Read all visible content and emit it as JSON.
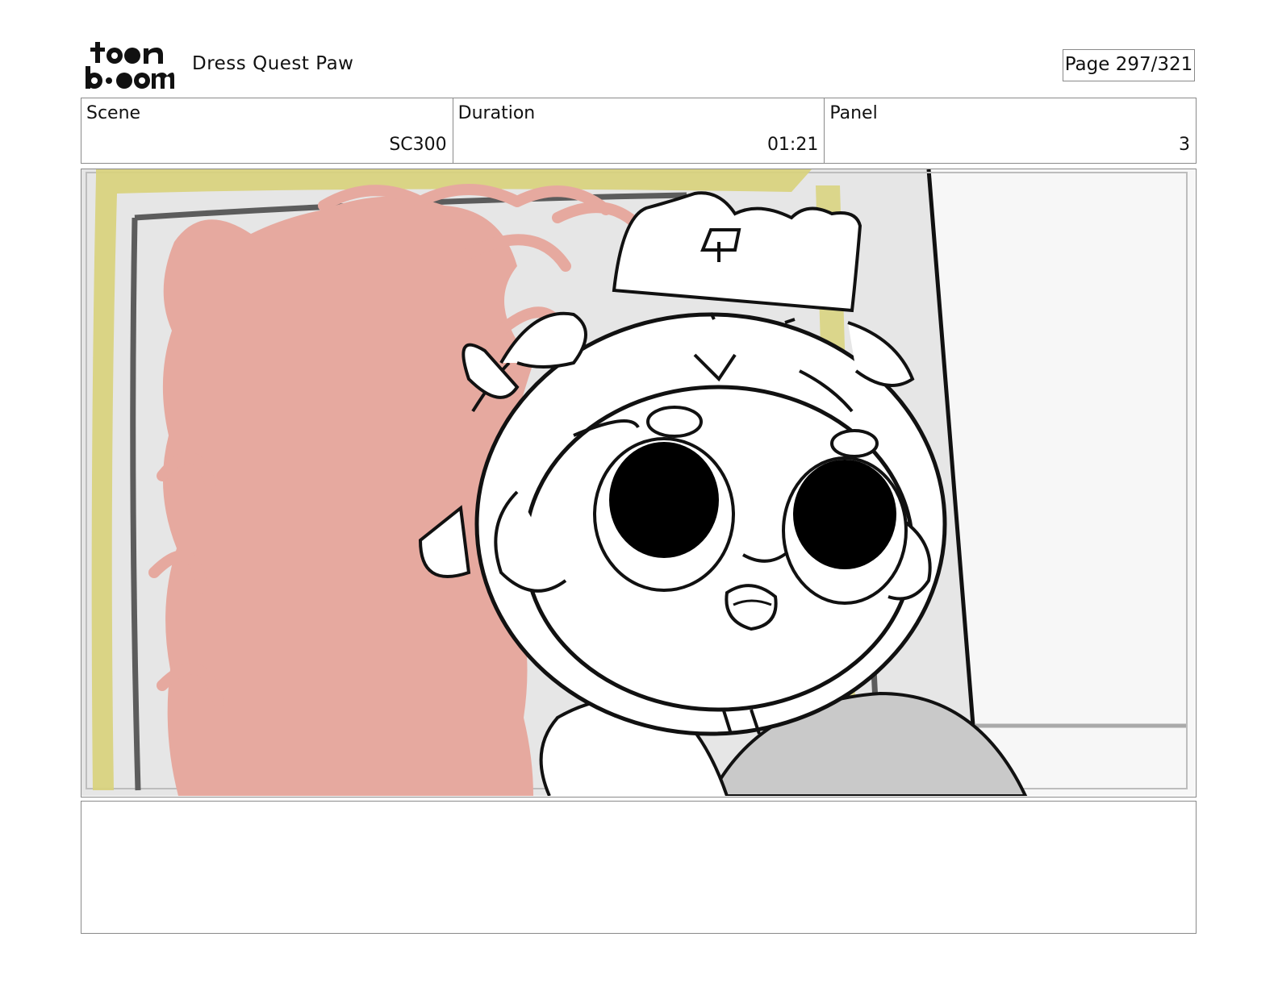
{
  "header": {
    "logo_text": "toonboom",
    "title": "Dress Quest Paw",
    "page_label": "Page 297/321"
  },
  "info": {
    "scene_label": "Scene",
    "scene_value": "SC300",
    "duration_label": "Duration",
    "duration_value": "01:21",
    "panel_label": "Panel",
    "panel_value": "3"
  },
  "notes": {
    "text": ""
  },
  "colors": {
    "frame_yellow": "#d8d27a",
    "painting_pink": "#e6a99f",
    "wall_gray": "#e6e6e6",
    "door_light": "#f7f7f7",
    "ball_gray": "#c9c9c9",
    "border": "#8a8a8a"
  }
}
